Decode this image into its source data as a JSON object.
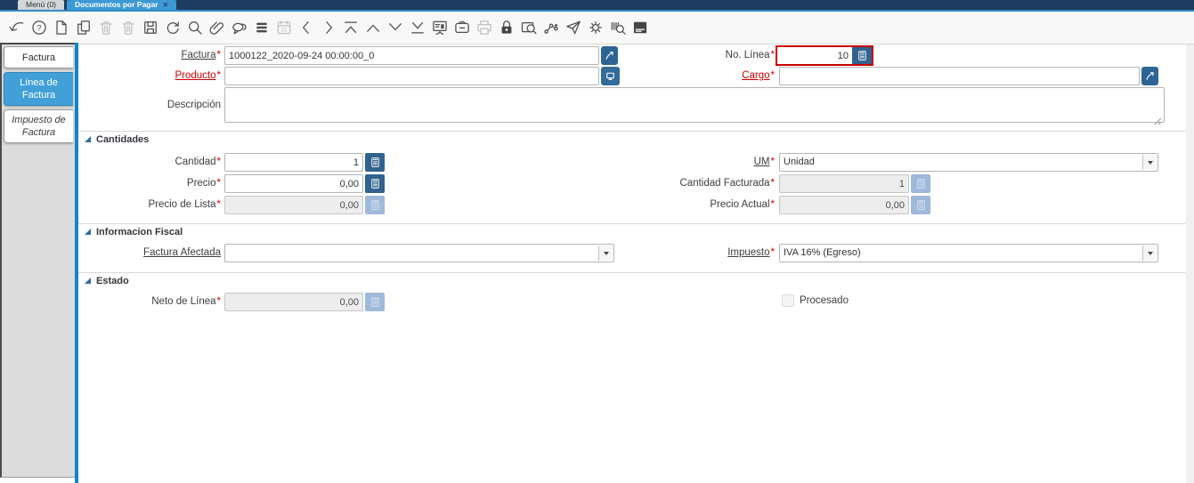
{
  "window_tabs": [
    {
      "label": "Menú (0)",
      "active": false
    },
    {
      "label": "Documentos por Pagar",
      "active": true,
      "close_icon": "✕"
    }
  ],
  "toolbar": {
    "icons": [
      {
        "name": "undo",
        "enabled": true
      },
      {
        "name": "help",
        "enabled": true
      },
      {
        "name": "new-record",
        "enabled": true
      },
      {
        "name": "copy-record",
        "enabled": true
      },
      {
        "name": "delete-record",
        "enabled": false
      },
      {
        "name": "delete-selection",
        "enabled": false
      },
      {
        "name": "save",
        "enabled": true
      },
      {
        "name": "refresh",
        "enabled": true
      },
      {
        "name": "find",
        "enabled": true
      },
      {
        "name": "attachment",
        "enabled": true
      },
      {
        "name": "chat",
        "enabled": true
      },
      {
        "name": "toggle-grid",
        "enabled": true
      },
      {
        "name": "calendar",
        "enabled": false
      },
      {
        "name": "previous-record",
        "enabled": true
      },
      {
        "name": "next-record",
        "enabled": true
      },
      {
        "name": "first-record",
        "enabled": true
      },
      {
        "name": "parent-record",
        "enabled": true
      },
      {
        "name": "detail-record",
        "enabled": true
      },
      {
        "name": "last-record",
        "enabled": true
      },
      {
        "name": "report",
        "enabled": true
      },
      {
        "name": "archive",
        "enabled": true
      },
      {
        "name": "print",
        "enabled": false
      },
      {
        "name": "private-record-lock",
        "enabled": true
      },
      {
        "name": "zoom-across",
        "enabled": true
      },
      {
        "name": "workflow",
        "enabled": true
      },
      {
        "name": "send-request",
        "enabled": true
      },
      {
        "name": "process",
        "enabled": true
      },
      {
        "name": "product-info",
        "enabled": true
      },
      {
        "name": "report-view",
        "enabled": true
      }
    ]
  },
  "sidebar_tabs": [
    {
      "label": "Factura",
      "active": false,
      "italic": false
    },
    {
      "label": "Línea de Factura",
      "active": true,
      "italic": false
    },
    {
      "label": "Impuesto de Factura",
      "active": false,
      "italic": true
    }
  ],
  "required_marker": "*",
  "form": {
    "factura": {
      "label": "Factura",
      "value": "1000122_2020-09-24 00:00:00_0"
    },
    "no_linea": {
      "label": "No. Línea",
      "value": "10"
    },
    "producto": {
      "label": "Producto",
      "value": ""
    },
    "cargo": {
      "label": "Cargo",
      "value": ""
    },
    "descripcion": {
      "label": "Descripción",
      "value": ""
    },
    "section_cantidades": {
      "title": "Cantidades"
    },
    "cantidad": {
      "label": "Cantidad",
      "value": "1"
    },
    "um": {
      "label": "UM",
      "value": "Unidad"
    },
    "precio": {
      "label": "Precio",
      "value": "0,00"
    },
    "cantidad_facturada": {
      "label": "Cantidad Facturada",
      "value": "1"
    },
    "precio_de_lista": {
      "label": "Precio de Lista",
      "value": "0,00"
    },
    "precio_actual": {
      "label": "Precio Actual",
      "value": "0,00"
    },
    "section_fiscal": {
      "title": "Informacion Fiscal"
    },
    "factura_afectada": {
      "label": "Factura Afectada",
      "value": ""
    },
    "impuesto": {
      "label": "Impuesto",
      "value": "IVA 16% (Egreso)"
    },
    "section_estado": {
      "title": "Estado"
    },
    "neto_de_linea": {
      "label": "Neto de Línea",
      "value": "0,00"
    },
    "procesado": {
      "label": "Procesado",
      "checked": false
    }
  },
  "colors": {
    "tabbar_bg": "#1e3c60",
    "active_tab_blue": "#3d99d4",
    "sidebar_active_blue": "#41a0d8",
    "accent_blue_bar": "#0d87ca",
    "zoom_button_blue": "#2d6496",
    "calc_button_blue": "#32628f",
    "calc_button_disabled": "#9fb9da",
    "required_red": "#cc0000",
    "focus_border_red": "#cc0000"
  }
}
